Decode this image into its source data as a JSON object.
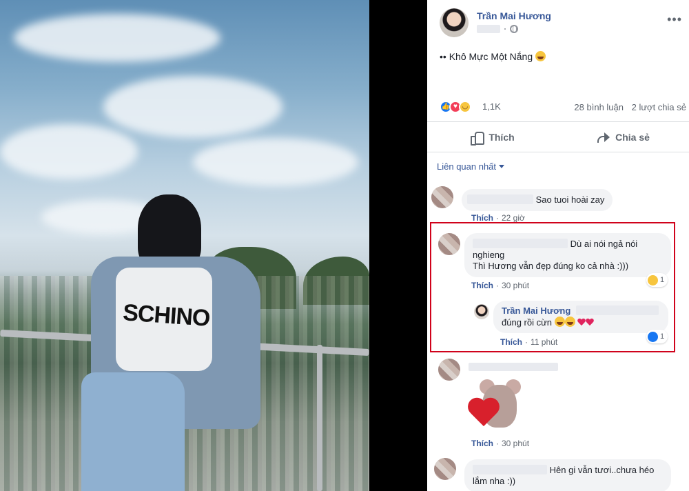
{
  "photo": {
    "shirt_text": "SCHINO"
  },
  "post": {
    "poster_name": "Trần Mai Hương",
    "text": "•• Khô Mực Một Nắng",
    "reactions": {
      "count": "1,1K",
      "comments": "28 bình luận",
      "shares": "2 lượt chia sẻ"
    },
    "actions": {
      "like": "Thích",
      "share": "Chia sẻ"
    },
    "sort_label": "Liên quan nhất"
  },
  "comments": [
    {
      "text": "Sao tuoi hoài zay",
      "like_label": "Thích",
      "time": "22 giờ"
    },
    {
      "text_line1": "Dù ai nói ngả nói",
      "text_line2": "nghieng",
      "text_line3": "Thì Hương vẫn đẹp đúng ko cả nhà :)))",
      "like_label": "Thích",
      "time": "30 phút",
      "reaction_count": "1",
      "reply": {
        "author": "Trần Mai Hương",
        "text": "đúng rồi cừn",
        "like_label": "Thích",
        "time": "11 phút",
        "reaction_count": "1"
      }
    },
    {
      "like_label": "Thích",
      "time": "30 phút"
    },
    {
      "text_line1": "Hên gi vẫn tươi..chưa héo",
      "text_line2": "lắm nha :))"
    }
  ],
  "colors": {
    "link": "#385898",
    "highlight": "#d0021b",
    "like_blue": "#1877f2",
    "love_red": "#f33e58",
    "haha_yellow": "#f7c53e"
  }
}
